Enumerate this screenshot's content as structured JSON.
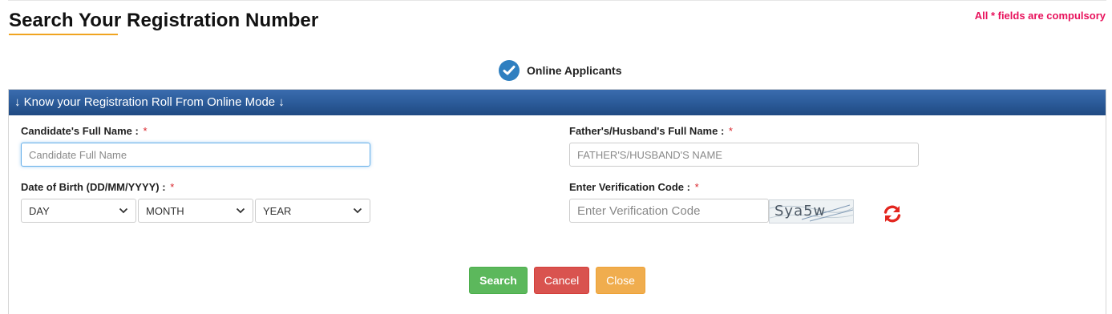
{
  "header": {
    "title": "Search Your Registration Number",
    "compulsory_note": "All * fields are compulsory"
  },
  "option": {
    "label": "Online Applicants",
    "checked": true
  },
  "panel": {
    "title": "↓ Know your Registration Roll From Online Mode ↓"
  },
  "form": {
    "required_mark": "*",
    "candidate_name": {
      "label": "Candidate's Full Name :",
      "placeholder": "Candidate Full Name"
    },
    "father_name": {
      "label": "Father's/Husband's Full Name :",
      "placeholder": "FATHER'S/HUSBAND'S NAME"
    },
    "dob": {
      "label": "Date of Birth (DD/MM/YYYY) :",
      "day": "DAY",
      "month": "MONTH",
      "year": "YEAR"
    },
    "verification": {
      "label": "Enter Verification Code :",
      "placeholder": "Enter Verification Code",
      "captcha_text": "Sya5w"
    }
  },
  "buttons": {
    "search": "Search",
    "cancel": "Cancel",
    "close": "Close"
  },
  "colors": {
    "accent_orange": "#f0a420",
    "required_red": "#d9262c",
    "note_pink": "#e8125c",
    "header_blue": "#2d5d9c",
    "search_green": "#5cb85c",
    "cancel_red": "#d9534f",
    "close_orange": "#f0ad4e"
  },
  "icons": {
    "option_check": "check-circle-icon",
    "refresh": "refresh-icon",
    "dropdown": "chevron-down-icon"
  }
}
